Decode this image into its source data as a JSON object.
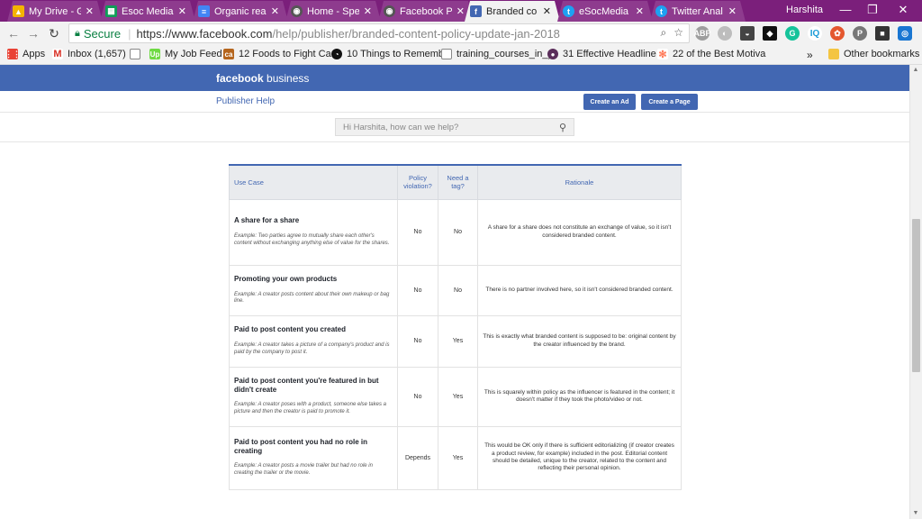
{
  "browser": {
    "tabs": [
      {
        "title": "My Drive - G",
        "icon": "google-drive-icon",
        "color": "#f4b400",
        "active": false
      },
      {
        "title": "Esoc Media",
        "icon": "sheets-icon",
        "color": "#0f9d58",
        "active": false
      },
      {
        "title": "Organic reac",
        "icon": "docs-icon",
        "color": "#4285f4",
        "active": false
      },
      {
        "title": "Home - Spe",
        "icon": "speaker-icon",
        "color": "#555555",
        "active": false
      },
      {
        "title": "Facebook Pi",
        "icon": "speaker-icon",
        "color": "#555555",
        "active": false
      },
      {
        "title": "Branded co",
        "icon": "facebook-icon",
        "color": "#4267b2",
        "active": true
      },
      {
        "title": "eSocMedia",
        "icon": "twitter-icon",
        "color": "#1da1f2",
        "active": false
      },
      {
        "title": "Twitter Anal",
        "icon": "twitter-icon",
        "color": "#1da1f2",
        "active": false
      }
    ],
    "user": "Harshita",
    "secure_label": "Secure",
    "url_host": "https://www.facebook.com",
    "url_path": "/help/publisher/branded-content-policy-update-jan-2018",
    "bookmarks": [
      {
        "label": "Apps",
        "icon": "apps-grid-icon"
      },
      {
        "label": "Inbox (1,657)",
        "icon": "gmail-icon"
      },
      {
        "label": "",
        "icon": "page-icon"
      },
      {
        "label": "My Job Feed",
        "icon": "upwork-icon"
      },
      {
        "label": "12 Foods to Fight Can",
        "icon": "ca-icon"
      },
      {
        "label": "10 Things to Rememb",
        "icon": "circle-logo-icon"
      },
      {
        "label": "training_courses_in_y",
        "icon": "page-icon"
      },
      {
        "label": "31 Effective Headline",
        "icon": "avatar-icon"
      },
      {
        "label": "22 of the Best Motiva",
        "icon": "hubspot-icon"
      },
      {
        "label": "Other bookmarks",
        "icon": "folder-icon"
      }
    ],
    "more_bookmarks": "»"
  },
  "page": {
    "brand_bold": "facebook",
    "brand_rest": " business",
    "publisher_help": "Publisher Help",
    "create_ad": "Create an Ad",
    "create_page": "Create a Page",
    "search_placeholder": "Hi Harshita, how can we help?"
  },
  "table": {
    "headers": {
      "use_case": "Use Case",
      "policy_violation": "Policy violation?",
      "need_tag": "Need a tag?",
      "rationale": "Rationale"
    },
    "rows": [
      {
        "title": "A share for a share",
        "example": "Example: Two parties agree to mutually share each other's content without exchanging anything else of value for the shares.",
        "violation": "No",
        "tag": "No",
        "rationale": "A share for a share does not constitute an exchange of value, so it isn't considered branded content."
      },
      {
        "title": "Promoting your own products",
        "example": "Example: A creator posts content about their own makeup or bag line.",
        "violation": "No",
        "tag": "No",
        "rationale": "There is no partner involved here, so it isn't considered branded content."
      },
      {
        "title": "Paid to post content you created",
        "example": "Example: A creator takes a picture of a company's product and is paid by the company to post it.",
        "violation": "No",
        "tag": "Yes",
        "rationale": "This is exactly what branded content is supposed to be: original content by the creator influenced by the brand."
      },
      {
        "title": "Paid to post content you're featured in but didn't create",
        "example": "Example: A creator poses with a product, someone else takes a picture and then the creator is paid to promote it.",
        "violation": "No",
        "tag": "Yes",
        "rationale": "This is squarely within policy as the influencer is featured in the content; it doesn't matter if they took the photo/video or not."
      },
      {
        "title": "Paid to post content you had no role in creating",
        "example": "Example: A creator posts a movie trailer but had no role in creating the trailer or the movie.",
        "violation": "Depends",
        "tag": "Yes",
        "rationale": "This would be OK only if there is sufficient editorializing (if creator creates a product review, for example) included in the post. Editorial content should be detailed, unique to the creator, related to the content and reflecting their personal opinion."
      }
    ]
  }
}
